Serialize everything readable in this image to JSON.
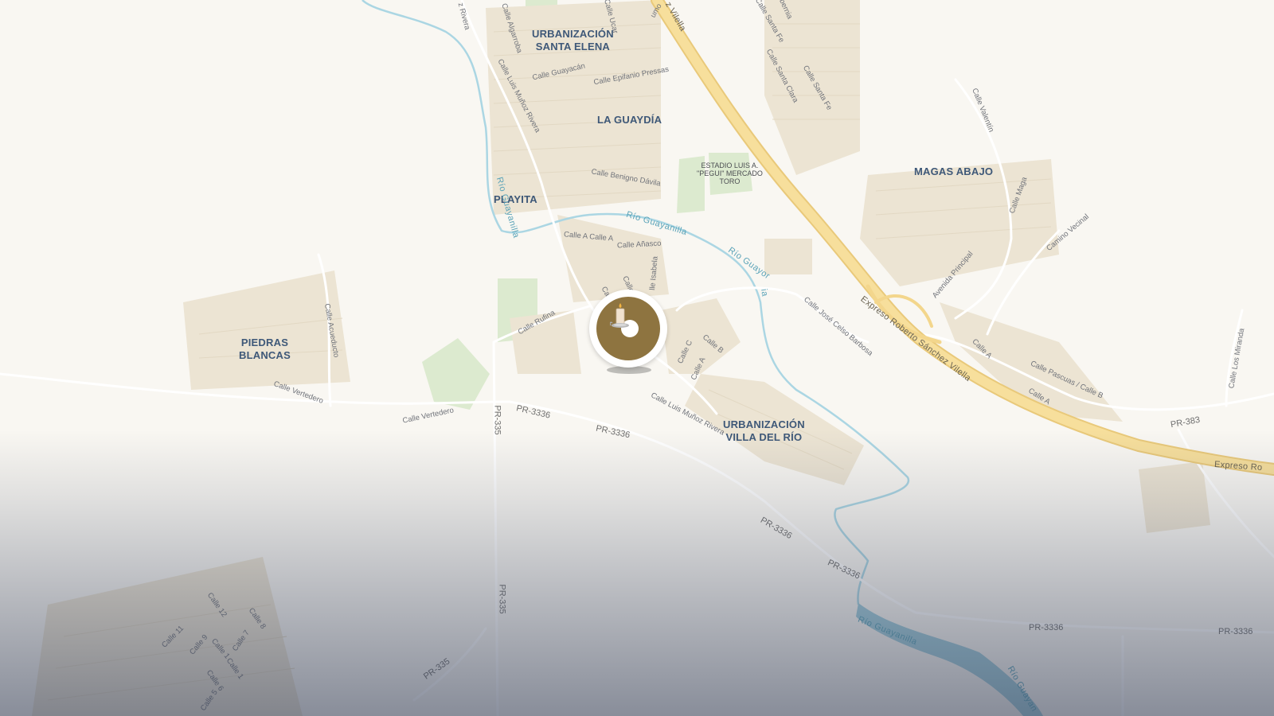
{
  "places": {
    "santa_elena": "URBANIZACIÓN\nSANTA ELENA",
    "la_guaydia": "LA GUAYDÍA",
    "playita": "PLAYITA",
    "magas_abajo": "MAGAS ABAJO",
    "piedras_blancas": "PIEDRAS\nBLANCAS",
    "villa_del_rio": "URBANIZACIÓN\nVILLA DEL RÍO"
  },
  "poi": {
    "estadio": "ESTADIO LUIS A.\n\"PEGUI\" MERCADO\nTORO"
  },
  "water": {
    "rio_1": "Río Guayanilla",
    "rio_2": "Río Guayanilla",
    "rio_3": "Río Guayor",
    "rio_3b": "ia",
    "rio_4": "Río Guayanilla",
    "rio_5": "Río Guayan"
  },
  "highway": {
    "label_1": "Expreso Roberto Sánchez Vilella",
    "label_2": "Expreso Ro",
    "label_3": "z Vilella"
  },
  "routes": {
    "pr3336_a": "PR-3336",
    "pr3336_b": "PR-3336",
    "pr3336_c": "PR-3336",
    "pr3336_d": "PR-3336",
    "pr3336_e": "PR-3336",
    "pr3336_f": "PR-3336",
    "pr335_a": "PR-335",
    "pr335_b": "PR-335",
    "pr335_c": "PR-335",
    "pr383": "PR-383"
  },
  "streets": {
    "algarroba": "Calle Algarroba",
    "ucar": "Calle Ucar",
    "luis_munoz_rivera_n": "Calle Luis Muñoz Rivera",
    "munoz_rivera_left": "z Rivera",
    "guayacan": "Calle Guayacán",
    "epifanio": "Calle Epifanio Pressas",
    "benigno": "Calle Benigno Dávila",
    "calle_a_calle_a": "Calle A Calle A",
    "anasco": "Calle Añasco",
    "isabela": "lle Isabela",
    "calle_1": "Calle",
    "calle_2": "Calle",
    "rufina": "Calle Rufina",
    "calle_c": "Calle C",
    "calle_b": "Calle B",
    "calle_a_mid": "Calle A",
    "luis_munoz_rivera_s": "Calle Luis Muñoz Rivera",
    "jose_celso": "Calle José Celso Barbosa",
    "vertedero_1": "Calle Vertedero",
    "vertedero_2": "Calle Vertedero",
    "acueducto": "Calle Acueducto",
    "santa_fe_1": "Calle Santa Fe",
    "santa_fe_2": "Calle Santa Fe",
    "santa_clara": "Calle Santa Clara",
    "hibernia": "ibernia",
    "uno": "umo",
    "valentin": "Calle Valentín",
    "maga": "Calle Maga",
    "camino_vecinal": "Camino Vecinal",
    "avenida_principal": "Avenida Principal",
    "calle_a_east1": "Calle A",
    "calle_a_east2": "Calle A",
    "pascuas": "Calle Pascuas / Calle B",
    "los_miranda": "Calle Los Miranda",
    "calle_12": "Calle 12",
    "calle_8": "Calle 8",
    "calle_11": "Calle 11",
    "calle_9": "Calle 9",
    "calle_1b": "Calle 1",
    "calle_7": "Calle 7",
    "calle_1c": "Calle 1",
    "calle_6": "Calle 6",
    "calle_5": "Calle 5"
  },
  "marker": {
    "icon": "candle-icon",
    "color": "#8e7440"
  },
  "colors": {
    "background": "#f9f7f2",
    "highway": "#f6dc97",
    "river": "#a8d5e2",
    "park": "#d8e9cf",
    "building": "#ebe3d2"
  }
}
